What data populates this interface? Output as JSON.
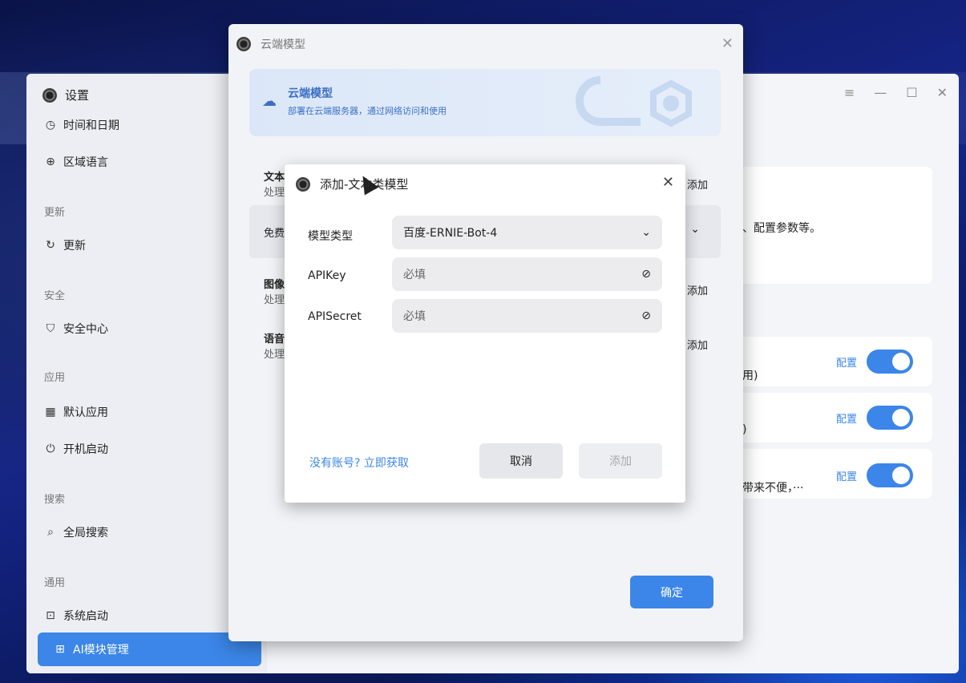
{
  "settings": {
    "title": "设置",
    "sidebar": {
      "items": [
        {
          "icon": "clock-icon",
          "glyph": "◷",
          "label": "时间和日期"
        },
        {
          "icon": "globe-icon",
          "glyph": "⊕",
          "label": "区域语言"
        },
        {
          "group": "更新"
        },
        {
          "icon": "refresh-icon",
          "glyph": "↻",
          "label": "更新"
        },
        {
          "group": "安全"
        },
        {
          "icon": "shield-icon",
          "glyph": "⛉",
          "label": "安全中心"
        },
        {
          "group": "应用"
        },
        {
          "icon": "apps-icon",
          "glyph": "▦",
          "label": "默认应用"
        },
        {
          "icon": "startup-icon",
          "glyph": "⏻",
          "label": "开机启动"
        },
        {
          "group": "搜索"
        },
        {
          "icon": "search-icon",
          "glyph": "⌕",
          "label": "全局搜索"
        },
        {
          "group": "通用"
        },
        {
          "icon": "boot-icon",
          "glyph": "⊡",
          "label": "系统启动"
        }
      ],
      "active": {
        "icon": "ai-module-icon",
        "glyph": "⊞",
        "label": "AI模块管理"
      }
    },
    "window_controls": [
      "≡",
      "—",
      "☐",
      "✕"
    ],
    "main": {
      "desc_fragment": "、配置参数等。",
      "rows": [
        {
          "text_fragment": "用)",
          "config_label": "配置",
          "enabled": true
        },
        {
          "text_fragment": ")",
          "config_label": "配置",
          "enabled": true
        },
        {
          "text_fragment": "带来不便，···",
          "config_label": "配置",
          "enabled": true
        }
      ]
    }
  },
  "cloud_window": {
    "title": "云端模型",
    "banner": {
      "title": "云端模型",
      "subtitle": "部署在云端服务器，通过网络访问和使用"
    },
    "sections": [
      {
        "title": "文本",
        "sub": "处理",
        "add": "添加"
      },
      {
        "title": "免费",
        "sub": ""
      },
      {
        "title": "图像",
        "sub": "处理",
        "add": "添加"
      },
      {
        "title": "语音",
        "sub": "处理",
        "add": "添加"
      }
    ],
    "ok_label": "确定"
  },
  "dialog": {
    "title": "添加-文本类模型",
    "fields": [
      {
        "label": "模型类型",
        "value": "百度-ERNIE-Bot-4"
      },
      {
        "label": "APIKey",
        "placeholder": "必填"
      },
      {
        "label": "APISecret",
        "placeholder": "必填"
      }
    ],
    "link": "没有账号? 立即获取",
    "cancel_label": "取消",
    "add_label": "添加"
  }
}
